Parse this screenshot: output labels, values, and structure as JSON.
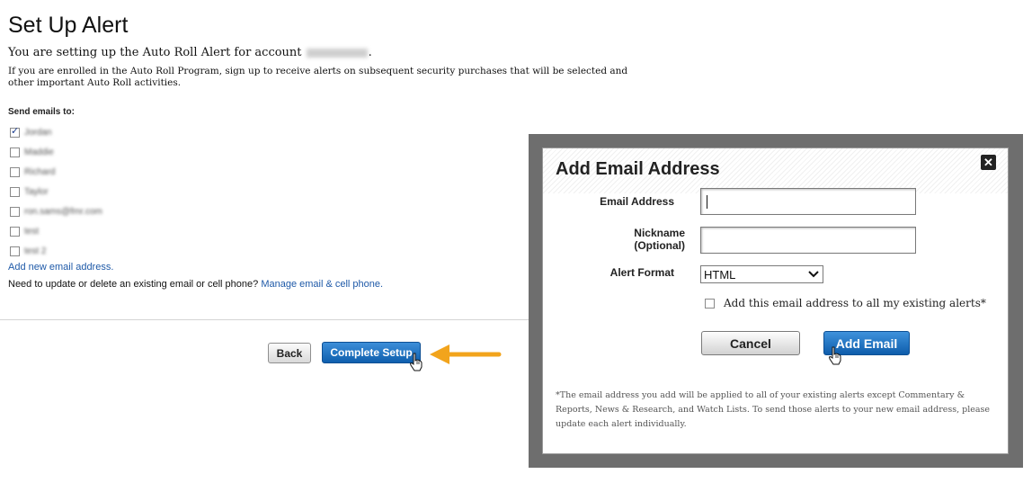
{
  "page": {
    "title": "Set Up Alert",
    "intro_prefix": "You are setting up the Auto Roll Alert for account",
    "intro_suffix": ".",
    "description": "If you are enrolled in the Auto Roll Program, sign up to receive alerts on subsequent security purchases that will be selected and other important Auto Roll activities.",
    "send_label": "Send emails to:",
    "emails": [
      {
        "label": "Jordan",
        "checked": true
      },
      {
        "label": "Maddie",
        "checked": false
      },
      {
        "label": "Richard",
        "checked": false
      },
      {
        "label": "Taylor",
        "checked": false
      },
      {
        "label": "ron.sams@fmr.com",
        "checked": false
      },
      {
        "label": "test",
        "checked": false
      },
      {
        "label": "test 2",
        "checked": false
      }
    ],
    "add_new_link": "Add new email address.",
    "update_prefix": "Need to update or delete an existing email or cell phone?",
    "update_link": "Manage email & cell phone.",
    "back_label": "Back",
    "complete_label": "Complete Setup"
  },
  "modal": {
    "title": "Add Email Address",
    "close_symbol": "✕",
    "email_label": "Email Address",
    "email_value": "",
    "nickname_label_1": "Nickname",
    "nickname_label_2": "(Optional)",
    "nickname_value": "",
    "format_label": "Alert Format",
    "format_selected": "HTML",
    "all_alerts_label": "Add this email address to all my existing alerts*",
    "all_alerts_checked": false,
    "cancel_label": "Cancel",
    "add_label": "Add Email",
    "footnote": "*The email address you add will be applied to all of your existing alerts except Commentary & Reports, News & Research, and Watch Lists. To send those alerts to your new email address, please update each alert individually."
  },
  "colors": {
    "link": "#1f5aa8",
    "primary_button": "#0f5fae",
    "annotation_arrow": "#f2a41c",
    "modal_frame": "#6e6e6e"
  },
  "icons": {
    "cursor": "hand-pointer-icon",
    "arrow": "arrow-left-icon",
    "close": "close-icon",
    "select_chevron": "chevron-down-icon"
  }
}
